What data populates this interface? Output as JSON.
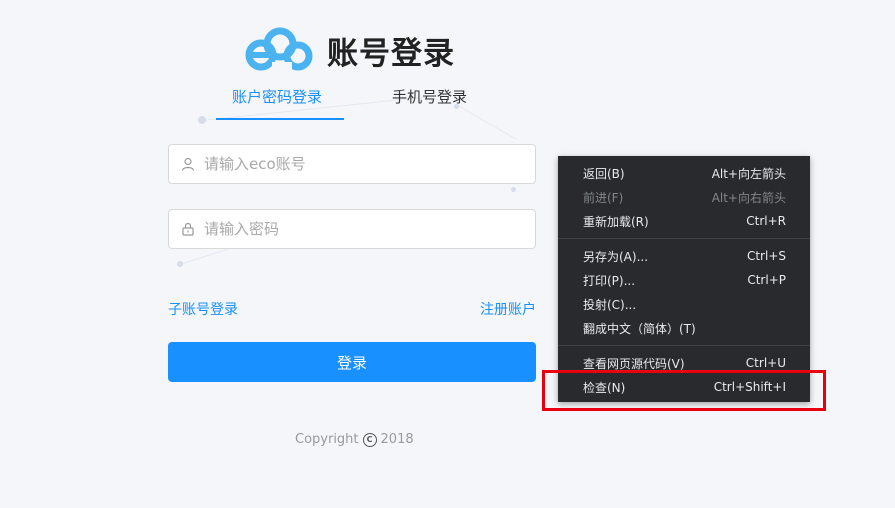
{
  "page": {
    "title": "账号登录"
  },
  "tabs": [
    {
      "label": "账户密码登录",
      "active": true
    },
    {
      "label": "手机号登录",
      "active": false
    }
  ],
  "form": {
    "username": {
      "value": "",
      "placeholder": "请输入eco账号",
      "icon": "user-icon"
    },
    "password": {
      "value": "",
      "placeholder": "请输入密码",
      "icon": "lock-icon"
    },
    "sub_account_link": "子账号登录",
    "register_link": "注册账户",
    "submit_label": "登录"
  },
  "footer": {
    "copyright_prefix": "Copyright",
    "copyright_symbol": "C",
    "year": "2018"
  },
  "context_menu": {
    "items": [
      {
        "label": "返回(B)",
        "shortcut": "Alt+向左箭头",
        "disabled": false
      },
      {
        "label": "前进(F)",
        "shortcut": "Alt+向右箭头",
        "disabled": true
      },
      {
        "label": "重新加载(R)",
        "shortcut": "Ctrl+R",
        "disabled": false
      },
      {
        "label": "另存为(A)...",
        "shortcut": "Ctrl+S",
        "disabled": false
      },
      {
        "label": "打印(P)...",
        "shortcut": "Ctrl+P",
        "disabled": false
      },
      {
        "label": "投射(C)...",
        "shortcut": "",
        "disabled": false
      },
      {
        "label": "翻成中文（简体）(T)",
        "shortcut": "",
        "disabled": false
      },
      {
        "label": "查看网页源代码(V)",
        "shortcut": "Ctrl+U",
        "disabled": false
      },
      {
        "label": "检查(N)",
        "shortcut": "Ctrl+Shift+I",
        "disabled": false
      }
    ]
  },
  "colors": {
    "accent": "#1890ff",
    "logo": "#4ab3f0",
    "menu_bg": "#292a2d",
    "highlight": "#e8000e"
  }
}
